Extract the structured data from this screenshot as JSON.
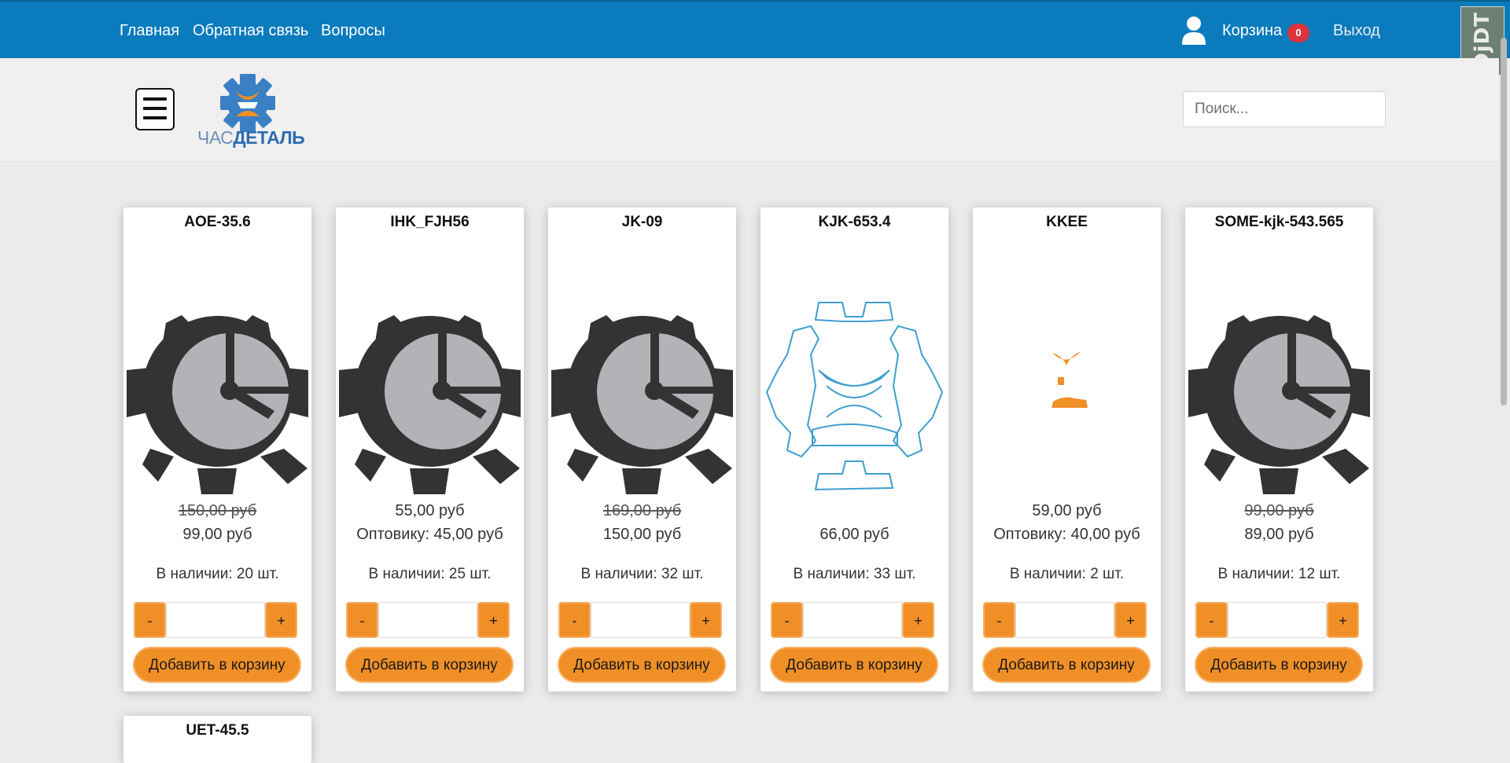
{
  "nav": {
    "links": [
      "Главная",
      "Обратная связь",
      "Вопросы"
    ],
    "cart_label": "Корзина",
    "cart_count": "0",
    "logout": "Выход",
    "debug_toolbar": "DjDT"
  },
  "header": {
    "logo_part1": "ЧАС",
    "logo_part2": "ДЕТАЛЬ",
    "search_placeholder": "Поиск..."
  },
  "colors": {
    "navbar": "#0a7bbd",
    "accent": "#f18f27",
    "badge": "#d9343c"
  },
  "products": [
    {
      "title": "AOE-35.6",
      "image": "clock-gear-icon",
      "line1": "150,00 руб",
      "line1_strike": true,
      "line2": "99,00 руб",
      "stock": "В наличии: 20 шт."
    },
    {
      "title": "IHK_FJH56",
      "image": "clock-gear-icon",
      "line1": "55,00 руб",
      "line1_strike": false,
      "line2": "Оптовику: 45,00 руб",
      "stock": "В наличии: 25 шт."
    },
    {
      "title": "JK-09",
      "image": "clock-gear-icon",
      "line1": "169,00 руб",
      "line1_strike": true,
      "line2": "150,00 руб",
      "stock": "В наличии: 32 шт."
    },
    {
      "title": "KJK-653.4",
      "image": "gear-outline-logo-icon",
      "line1": "",
      "line1_strike": false,
      "line2": "66,00 руб",
      "stock": "В наличии: 33 шт."
    },
    {
      "title": "KKEE",
      "image": "orange-logo-fragment-icon",
      "line1": "59,00 руб",
      "line1_strike": false,
      "line2": "Оптовику: 40,00 руб",
      "stock": "В наличии: 2 шт."
    },
    {
      "title": "SOME-kjk-543.565",
      "image": "clock-gear-icon",
      "line1": "99,00 руб",
      "line1_strike": true,
      "line2": "89,00 руб",
      "stock": "В наличии: 12 шт."
    }
  ],
  "controls": {
    "minus": "-",
    "plus": "+",
    "add_to_cart": "Добавить в корзину"
  },
  "partial_product": {
    "title": "UET-45.5"
  }
}
